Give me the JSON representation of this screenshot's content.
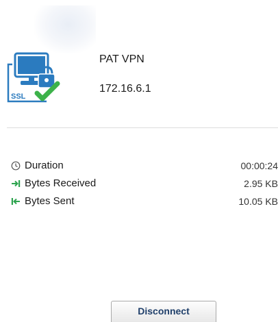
{
  "connection": {
    "name": "PAT VPN",
    "ip": "172.16.6.1",
    "icon": "ssl-vpn-connected-icon",
    "icon_label": "SSL",
    "accent_color": "#2b7bbf",
    "status_color": "#3db24a"
  },
  "stats": [
    {
      "label": "Duration",
      "value": "00:00:24",
      "icon": "clock-icon"
    },
    {
      "label": "Bytes Received",
      "value": "2.95 KB",
      "icon": "arrow-received-icon"
    },
    {
      "label": "Bytes Sent",
      "value": "10.05 KB",
      "icon": "arrow-sent-icon"
    }
  ],
  "actions": {
    "disconnect_label": "Disconnect"
  }
}
